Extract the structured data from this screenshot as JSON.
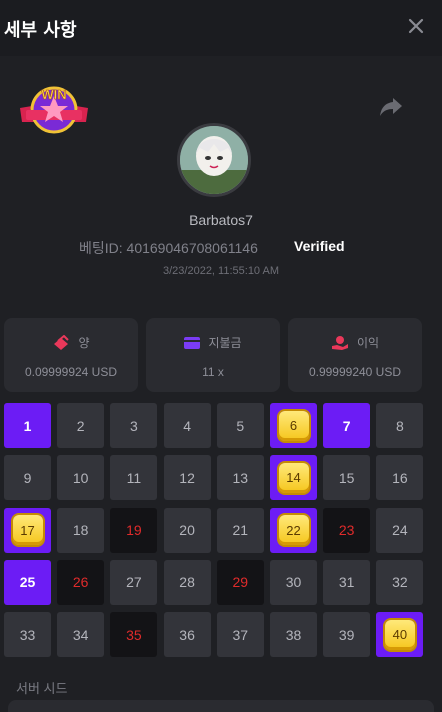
{
  "header": {
    "title": "세부 사항"
  },
  "bet": {
    "username": "Barbatos7",
    "bet_id": "베팅ID: 40169046708061146",
    "status": "Verified",
    "timestamp": "3/23/2022, 11:55:10 AM",
    "badge_text": "WIN"
  },
  "stats": [
    {
      "label": "양",
      "value": "0.09999924 USD",
      "icon": "coins-icon",
      "color": "#e9385a"
    },
    {
      "label": "지불금",
      "value": "11 x",
      "icon": "wallet-icon",
      "color": "#7b3cf5"
    },
    {
      "label": "이익",
      "value": "0.99999240 USD",
      "icon": "profit-hand-icon",
      "color": "#e9385a"
    }
  ],
  "numbers": [
    {
      "n": "1",
      "state": "picked"
    },
    {
      "n": "2",
      "state": "normal"
    },
    {
      "n": "3",
      "state": "normal"
    },
    {
      "n": "4",
      "state": "normal"
    },
    {
      "n": "5",
      "state": "normal"
    },
    {
      "n": "6",
      "state": "hit"
    },
    {
      "n": "7",
      "state": "picked"
    },
    {
      "n": "8",
      "state": "normal"
    },
    {
      "n": "9",
      "state": "normal"
    },
    {
      "n": "10",
      "state": "normal"
    },
    {
      "n": "11",
      "state": "normal"
    },
    {
      "n": "12",
      "state": "normal"
    },
    {
      "n": "13",
      "state": "normal"
    },
    {
      "n": "14",
      "state": "hit"
    },
    {
      "n": "15",
      "state": "normal"
    },
    {
      "n": "16",
      "state": "normal"
    },
    {
      "n": "17",
      "state": "hit"
    },
    {
      "n": "18",
      "state": "normal"
    },
    {
      "n": "19",
      "state": "drawn"
    },
    {
      "n": "20",
      "state": "normal"
    },
    {
      "n": "21",
      "state": "normal"
    },
    {
      "n": "22",
      "state": "hit"
    },
    {
      "n": "23",
      "state": "drawn"
    },
    {
      "n": "24",
      "state": "normal"
    },
    {
      "n": "25",
      "state": "picked"
    },
    {
      "n": "26",
      "state": "drawn"
    },
    {
      "n": "27",
      "state": "normal"
    },
    {
      "n": "28",
      "state": "normal"
    },
    {
      "n": "29",
      "state": "drawn"
    },
    {
      "n": "30",
      "state": "normal"
    },
    {
      "n": "31",
      "state": "normal"
    },
    {
      "n": "32",
      "state": "normal"
    },
    {
      "n": "33",
      "state": "normal"
    },
    {
      "n": "34",
      "state": "normal"
    },
    {
      "n": "35",
      "state": "drawn"
    },
    {
      "n": "36",
      "state": "normal"
    },
    {
      "n": "37",
      "state": "normal"
    },
    {
      "n": "38",
      "state": "normal"
    },
    {
      "n": "39",
      "state": "normal"
    },
    {
      "n": "40",
      "state": "hit"
    }
  ],
  "server_seed": {
    "label": "서버 시드"
  },
  "colors": {
    "accent": "#6c1cf5",
    "drawn_text": "#e02b2b",
    "background": "#1f2024"
  }
}
